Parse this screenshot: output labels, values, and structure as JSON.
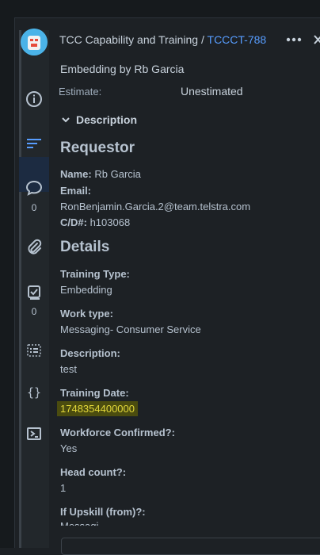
{
  "header": {
    "project": "TCC Capability and Training",
    "separator": "/",
    "issue_key": "TCCCT-788"
  },
  "rail": {
    "comments_count": "0",
    "checklist_count": "0"
  },
  "issue": {
    "summary": "Embedding by Rb Garcia",
    "estimate_label": "Estimate:",
    "estimate_value": "Unestimated",
    "description_label": "Description"
  },
  "requestor": {
    "heading": "Requestor",
    "name_label": "Name:",
    "name_value": "Rb Garcia",
    "email_label": "Email:",
    "email_value": "RonBenjamin.Garcia.2@team.telstra.com",
    "cd_label": "C/D#:",
    "cd_value": "h103068"
  },
  "details": {
    "heading": "Details",
    "fields": [
      {
        "label": "Training Type:",
        "value": "Embedding"
      },
      {
        "label": "Work type:",
        "value": "Messaging- Consumer Service"
      },
      {
        "label": "Description:",
        "value": "test"
      },
      {
        "label": "Training Date:",
        "value": "1748354400000"
      },
      {
        "label": "Workforce Confirmed?:",
        "value": "Yes"
      },
      {
        "label": "Head count?:",
        "value": "1"
      },
      {
        "label": "If Upskill (from)?:",
        "value": "Messagi..."
      }
    ]
  }
}
